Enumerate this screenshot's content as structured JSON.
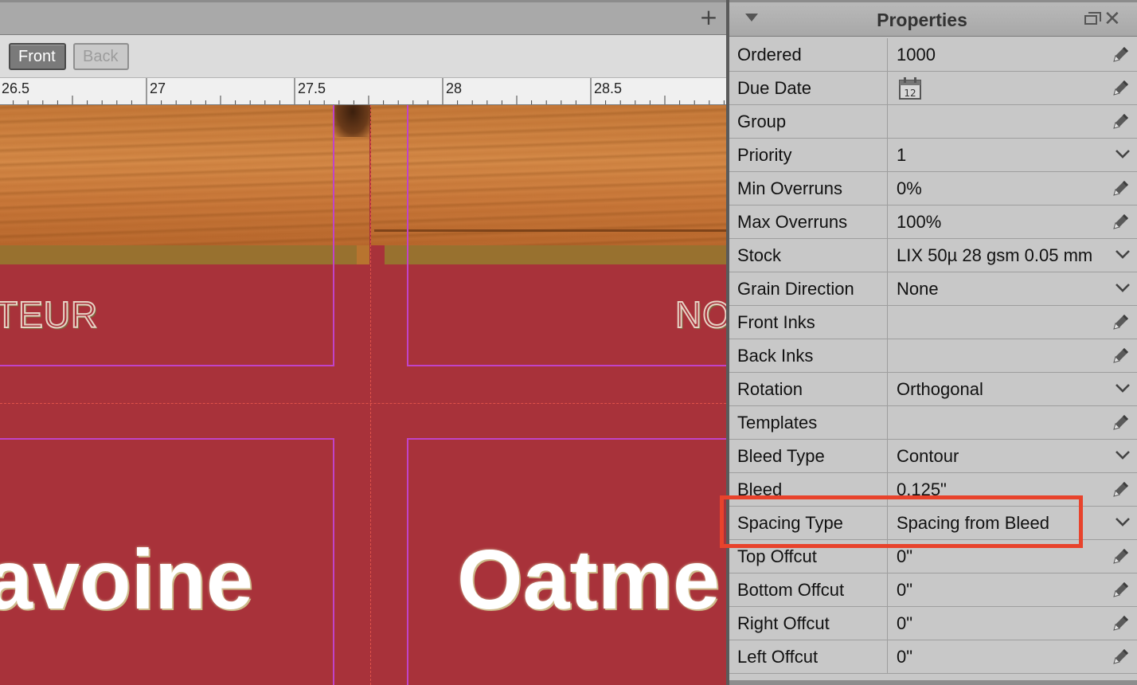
{
  "document": {
    "side_buttons": {
      "front": "Front",
      "back": "Back"
    },
    "ruler_labels": [
      "26.5",
      "27",
      "27.5",
      "28",
      "28.5"
    ],
    "canvas_text": {
      "teur": "TEUR",
      "no": "NO",
      "avoine": "avoine",
      "oatme": "Oatme"
    }
  },
  "properties": {
    "title": "Properties",
    "rows": [
      {
        "name": "Ordered",
        "value": "1000",
        "control": "edit"
      },
      {
        "name": "Due Date",
        "value": "",
        "calendar_day": "12",
        "control": "edit"
      },
      {
        "name": "Group",
        "value": "",
        "control": "edit"
      },
      {
        "name": "Priority",
        "value": "1",
        "control": "dropdown"
      },
      {
        "name": "Min Overruns",
        "value": "0%",
        "control": "edit"
      },
      {
        "name": "Max Overruns",
        "value": "100%",
        "control": "edit"
      },
      {
        "name": "Stock",
        "value": "LIX 50µ 28 gsm 0.05 mm",
        "control": "dropdown"
      },
      {
        "name": "Grain Direction",
        "value": "None",
        "control": "dropdown"
      },
      {
        "name": "Front Inks",
        "value": "",
        "control": "edit"
      },
      {
        "name": "Back Inks",
        "value": "",
        "control": "edit"
      },
      {
        "name": "Rotation",
        "value": "Orthogonal",
        "control": "dropdown"
      },
      {
        "name": "Templates",
        "value": "",
        "control": "edit"
      },
      {
        "name": "Bleed Type",
        "value": "Contour",
        "control": "dropdown"
      },
      {
        "name": "Bleed",
        "value": "0.125\"",
        "control": "edit"
      },
      {
        "name": "Spacing Type",
        "value": "Spacing from Bleed",
        "control": "dropdown"
      },
      {
        "name": "Top Offcut",
        "value": "0\"",
        "control": "edit"
      },
      {
        "name": "Bottom Offcut",
        "value": "0\"",
        "control": "edit"
      },
      {
        "name": "Right Offcut",
        "value": "0\"",
        "control": "edit"
      },
      {
        "name": "Left Offcut",
        "value": "0\"",
        "control": "edit"
      }
    ]
  },
  "colors": {
    "highlight": "#e8432c",
    "card_background": "#a8323a",
    "cut_line": "#c043c8"
  }
}
